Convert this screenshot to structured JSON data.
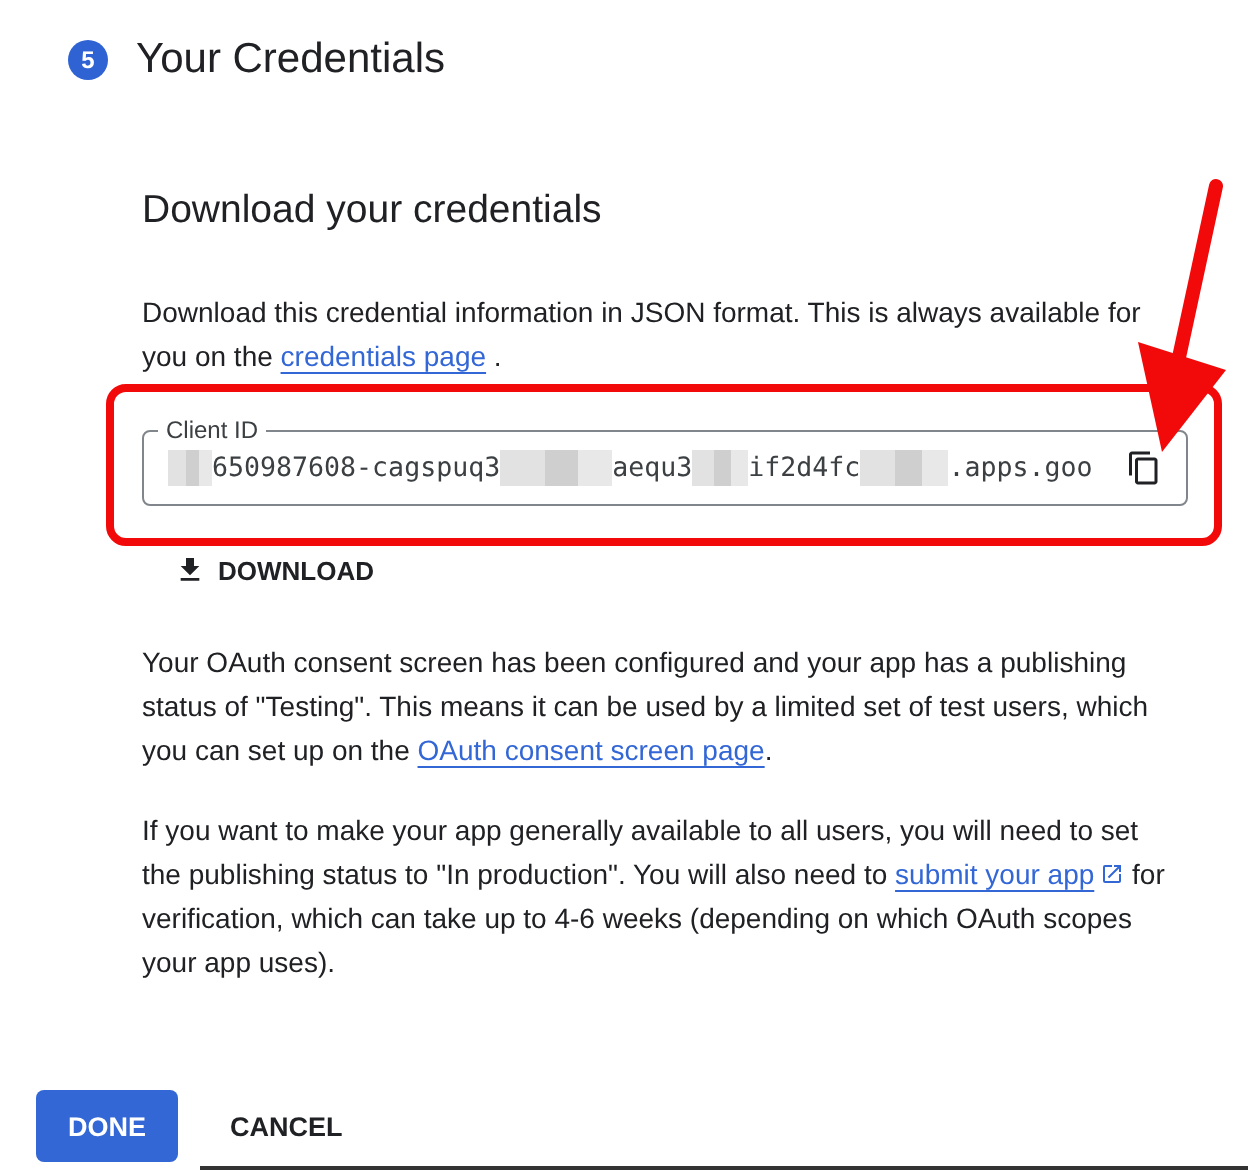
{
  "step": {
    "number": "5",
    "title": "Your Credentials"
  },
  "section": {
    "heading": "Download your credentials",
    "intro": [
      {
        "kind": "text",
        "text": "Download this credential information in JSON format. This is always available for you on the "
      },
      {
        "kind": "link",
        "text": "credentials page"
      },
      {
        "kind": "text",
        "text": " ."
      }
    ],
    "client_id": {
      "label": "Client ID",
      "value_parts": [
        {
          "kind": "redacted"
        },
        {
          "kind": "text",
          "text": "650987608-cagspuq3"
        },
        {
          "kind": "redacted"
        },
        {
          "kind": "text",
          "text": "aequ3"
        },
        {
          "kind": "redacted"
        },
        {
          "kind": "text",
          "text": "if2d4fc"
        },
        {
          "kind": "redacted"
        },
        {
          "kind": "text",
          "text": ".apps.goo"
        }
      ]
    },
    "download_button": "DOWNLOAD",
    "paragraphs": [
      [
        {
          "kind": "text",
          "text": "Your OAuth consent screen has been configured and your app has a publishing status of \"Testing\". This means it can be used by a limited set of test users, which you can set up on the "
        },
        {
          "kind": "link",
          "text": "OAuth consent screen page"
        },
        {
          "kind": "text",
          "text": "."
        }
      ],
      [
        {
          "kind": "text",
          "text": "If you want to make your app generally available to all users, you will need to set the publishing status to \"In production\". You will also need to "
        },
        {
          "kind": "external_link",
          "text": "submit your app"
        },
        {
          "kind": "text",
          "text": " for verification, which can take up to 4-6 weeks (depending on which OAuth scopes your app uses)."
        }
      ]
    ]
  },
  "buttons": [
    {
      "label": "DONE",
      "kind": "primary"
    },
    {
      "label": "CANCEL",
      "kind": "text"
    }
  ]
}
